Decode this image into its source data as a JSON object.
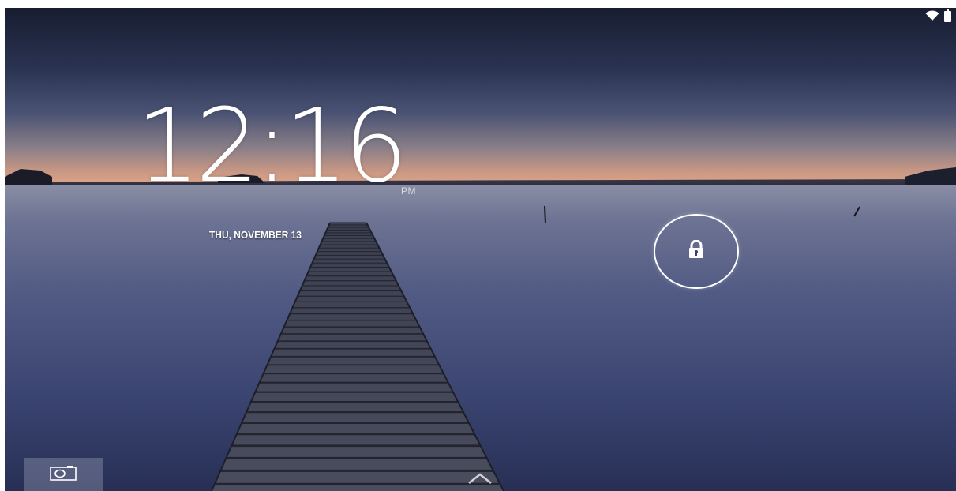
{
  "status_bar": {
    "icons": [
      "wifi-icon",
      "battery-icon"
    ]
  },
  "lockscreen": {
    "time": "12:16",
    "am_pm": "PM",
    "date": "THU, NOVEMBER 13",
    "lock_icon": "lock-icon",
    "camera_icon": "camera-icon",
    "swipe_up_icon": "chevron-up-icon"
  },
  "colors": {
    "sky_top": "#1c2237",
    "horizon_glow": "#c79785",
    "water": "#49517a",
    "foreground_text": "#ffffff"
  }
}
